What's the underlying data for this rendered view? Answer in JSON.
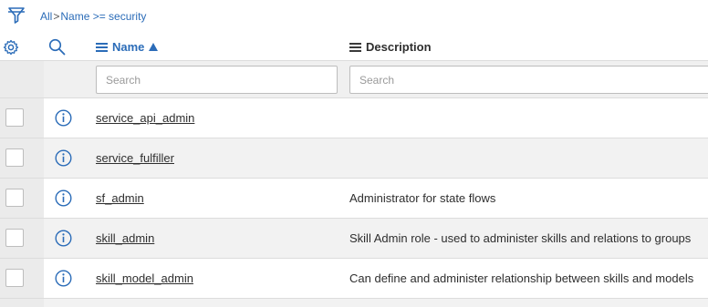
{
  "breadcrumb": {
    "root": "All",
    "separator": ">",
    "condition": "Name >= security"
  },
  "header": {
    "name_label": "Name",
    "description_label": "Description",
    "sort_direction": "ascending"
  },
  "search": {
    "name_placeholder": "Search",
    "description_placeholder": "Search"
  },
  "colors": {
    "link_blue": "#2b6cb8",
    "row_alt": "#f2f2f2",
    "side_gray": "#ebebeb"
  },
  "rows": [
    {
      "name": "service_api_admin",
      "description": ""
    },
    {
      "name": "service_fulfiller",
      "description": ""
    },
    {
      "name": "sf_admin",
      "description": "Administrator for state flows"
    },
    {
      "name": "skill_admin",
      "description": "Skill Admin role - used to administer skills and relations to groups"
    },
    {
      "name": "skill_model_admin",
      "description": "Can define and administer relationship between skills and models"
    }
  ]
}
